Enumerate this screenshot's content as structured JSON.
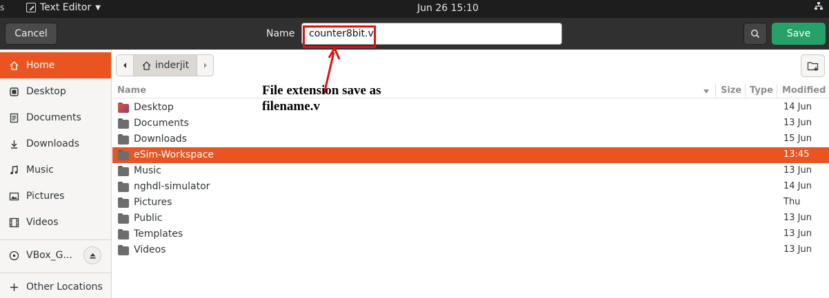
{
  "topbar": {
    "edge_glyph": "s",
    "app_name": "Text Editor",
    "clock": "Jun 26  15:10"
  },
  "header": {
    "cancel_label": "Cancel",
    "name_label": "Name",
    "filename_value": "counter8bit.v",
    "save_label": "Save"
  },
  "sidebar": {
    "items": [
      {
        "label": "Home",
        "icon": "home-icon"
      },
      {
        "label": "Desktop",
        "icon": "desktop-icon"
      },
      {
        "label": "Documents",
        "icon": "documents-icon"
      },
      {
        "label": "Downloads",
        "icon": "downloads-icon"
      },
      {
        "label": "Music",
        "icon": "music-icon"
      },
      {
        "label": "Pictures",
        "icon": "pictures-icon"
      },
      {
        "label": "Videos",
        "icon": "videos-icon"
      },
      {
        "label": "VBox_G...",
        "icon": "disc-icon"
      },
      {
        "label": "Other Locations",
        "icon": "plus-icon"
      }
    ]
  },
  "pathbar": {
    "current": "inderjit"
  },
  "columns": {
    "name": "Name",
    "size": "Size",
    "type": "Type",
    "modified": "Modified"
  },
  "files": [
    {
      "name": "Desktop",
      "modified": "14 Jun"
    },
    {
      "name": "Documents",
      "modified": "13 Jun"
    },
    {
      "name": "Downloads",
      "modified": "15 Jun"
    },
    {
      "name": "eSim-Workspace",
      "modified": "13:45"
    },
    {
      "name": "Music",
      "modified": "13 Jun"
    },
    {
      "name": "nghdl-simulator",
      "modified": "14 Jun"
    },
    {
      "name": "Pictures",
      "modified": "Thu"
    },
    {
      "name": "Public",
      "modified": "13 Jun"
    },
    {
      "name": "Templates",
      "modified": "13 Jun"
    },
    {
      "name": "Videos",
      "modified": "13 Jun"
    }
  ],
  "annotation": {
    "line1": "File extension save as",
    "line2": "filename.v"
  },
  "colors": {
    "accent": "#e95420",
    "save_green": "#26a269",
    "highlight_red": "#e01010"
  }
}
